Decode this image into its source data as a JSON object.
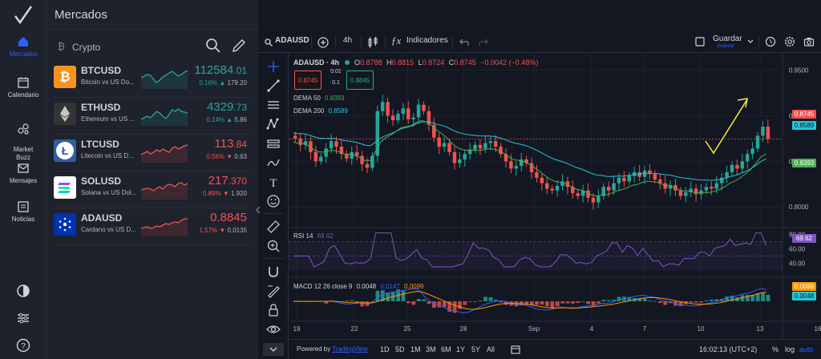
{
  "app": {
    "title": "Mercados"
  },
  "nav": {
    "items": [
      {
        "label": "Mercados"
      },
      {
        "label": "Calendario"
      },
      {
        "label": "Market\nBuzz"
      },
      {
        "label": "Mensajes"
      },
      {
        "label": "Noticias"
      }
    ]
  },
  "markets": {
    "category": "Crypto",
    "rows": [
      {
        "symbol": "BTCUSD",
        "name": "Bitcoin vs US Do...",
        "price_main": "112584",
        "price_dec": ".01",
        "change": "0.16%",
        "change_abs": "179.20",
        "direction": "up",
        "icon_color": "#f7931a",
        "spark": [
          12,
          10,
          8,
          9,
          14,
          18,
          15,
          11,
          9,
          6,
          4,
          7,
          10,
          8,
          5,
          3
        ]
      },
      {
        "symbol": "ETHUSD",
        "name": "Ethereum vs US ...",
        "price_main": "4329",
        "price_dec": ".73",
        "change": "0.14%",
        "change_abs": "5.86",
        "direction": "up",
        "icon_color": "#343434",
        "spark": [
          18,
          16,
          14,
          16,
          12,
          8,
          10,
          14,
          17,
          12,
          6,
          8,
          5,
          8,
          9,
          10
        ]
      },
      {
        "symbol": "LTCUSD",
        "name": "Litecoin vs US D...",
        "price_main": "113",
        "price_dec": ".84",
        "change": "0.56%",
        "change_abs": "0.63",
        "direction": "down",
        "icon_color": "#345d9d",
        "spark": [
          16,
          14,
          12,
          15,
          13,
          10,
          12,
          9,
          11,
          13,
          8,
          6,
          9,
          7,
          5,
          4
        ]
      },
      {
        "symbol": "SOLUSD",
        "name": "Solana vs US Dol...",
        "price_main": "217",
        "price_dec": ".370",
        "change": "0.89%",
        "change_abs": "1.920",
        "direction": "down",
        "icon_color": "#ffffff",
        "spark": [
          14,
          13,
          12,
          13,
          15,
          12,
          10,
          13,
          9,
          7,
          8,
          10,
          6,
          5,
          8,
          6
        ]
      },
      {
        "symbol": "ADAUSD",
        "name": "Cardano vs US D...",
        "price_main": "0.8845",
        "price_dec": "",
        "change": "1.57%",
        "change_abs": "0.0135",
        "direction": "down",
        "icon_color": "#0033ad",
        "spark": [
          16,
          15,
          14,
          16,
          15,
          13,
          14,
          12,
          10,
          11,
          9,
          8,
          9,
          6,
          4,
          4
        ]
      }
    ]
  },
  "toolbar": {
    "symbol": "ADAUSD",
    "interval": "4h",
    "indicators": "Indicadores",
    "save": "Guardar",
    "save_sub": "Guardar"
  },
  "chart": {
    "symbol_interval": "ADAUSD · 4h",
    "ohlc": {
      "o": "0.8788",
      "h": "0.8815",
      "l": "0.8724",
      "c": "0.8745",
      "chg": "−0.0042 (−0.48%)"
    },
    "sell_price": "0.8745",
    "spread": "0.01",
    "spread2": "0.1",
    "buy_price": "0.8845",
    "dema50_label": "DEMA 50",
    "dema50_value": "0.8393",
    "dema200_label": "DEMA 200",
    "dema200_value": "0.8589",
    "rsi_label": "RSI 14",
    "rsi_value": "69.62",
    "macd_label": "MACD 12 26 close 9",
    "macd_v1": "0.0048",
    "macd_v2": "0.0147",
    "macd_v3": "0.0099",
    "price_ticks": [
      "0.9500",
      "0.9000",
      "0.8500",
      "0.8000"
    ],
    "rsi_ticks": [
      "80.00",
      "60.00",
      "40.00"
    ],
    "x_ticks": [
      "19",
      "22",
      "25",
      "28",
      "Sep",
      "4",
      "7",
      "10",
      "13",
      "16"
    ],
    "last_price_badge": "0.8745",
    "dema200_badge": "0.8589",
    "dema50_badge": "0.8393",
    "rsi_badge": "69.62",
    "macd_badge1": "0.0099",
    "macd_badge2": "0.0048"
  },
  "footer": {
    "powered": "Powered by",
    "tv": "TradingView",
    "ranges": [
      "1D",
      "5D",
      "1M",
      "3M",
      "6M",
      "1Y",
      "5Y",
      "All"
    ],
    "time": "16:02:13 (UTC+2)",
    "pct": "%",
    "log": "log",
    "auto": "auto"
  },
  "colors": {
    "accent": "#2962ff",
    "up": "#26a69a",
    "down": "#ef5350",
    "dema50": "#4caf50",
    "dema200": "#26c6da",
    "rsi": "#7e57c2",
    "annotation": "#ffeb3b"
  },
  "chart_data": {
    "type": "candlestick",
    "x_ticks": [
      "19",
      "22",
      "25",
      "28",
      "Sep",
      "4",
      "7",
      "10",
      "13",
      "16"
    ],
    "ylim": [
      0.78,
      0.96
    ],
    "last_close": 0.8745,
    "dema50_last": 0.8393,
    "dema200_last": 0.8589,
    "rsi_last": 69.62,
    "rsi_levels": [
      70,
      30
    ]
  }
}
